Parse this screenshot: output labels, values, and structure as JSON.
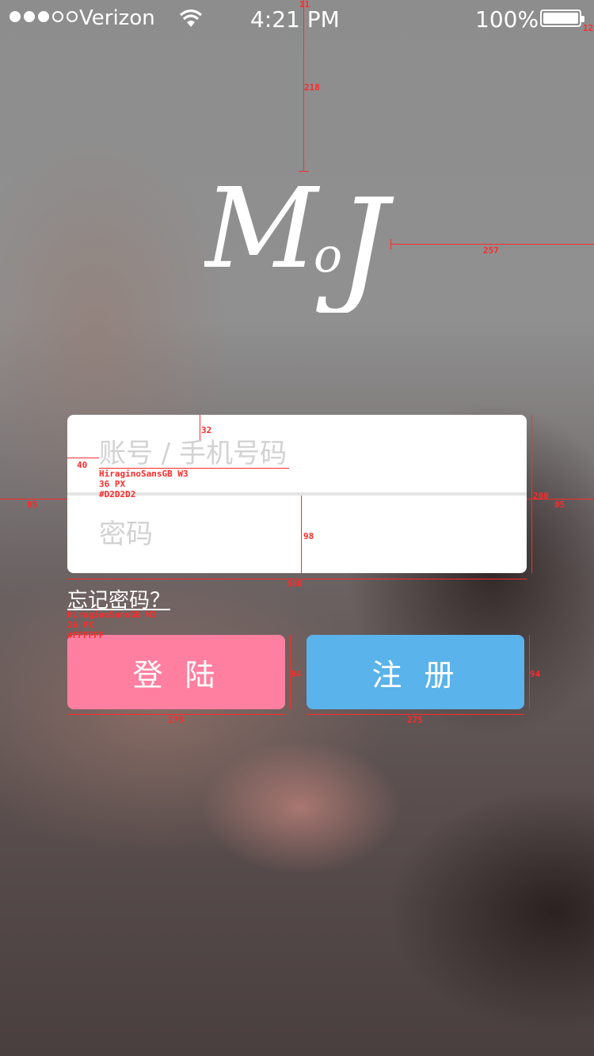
{
  "status_bar": {
    "carrier": "Verizon",
    "time": "4:21 PM",
    "battery": "100%"
  },
  "logo": {
    "text": "MoJ"
  },
  "form": {
    "account_placeholder": "账号 / 手机号码",
    "password_placeholder": "密码",
    "forgot_link": "忘记密码？"
  },
  "buttons": {
    "login": "登陆",
    "register": "注册"
  },
  "annotations": {
    "top_gap": "11",
    "right_gap_status": "12",
    "logo_top": "218",
    "logo_right": "257",
    "field_top": "32",
    "field_left": "40",
    "field_font_name": "HiraginoSansGB W3",
    "field_font_size": "36 PX",
    "field_font_color": "#D2D2D2",
    "card_left": "85",
    "card_right": "85",
    "card_height": "200",
    "field_height": "98",
    "card_width": "580",
    "forgot_font_name": "HiraginoSansGB W3",
    "forgot_font_size": "26 PX",
    "forgot_font_color": "#FFFFFF",
    "login_height": "94",
    "register_height": "94",
    "login_width": "275",
    "register_width": "275"
  },
  "colors": {
    "login_button": "#ff7fa0",
    "register_button": "#5ab3ea",
    "placeholder": "#D2D2D2",
    "annotation": "#ff2a2a"
  }
}
